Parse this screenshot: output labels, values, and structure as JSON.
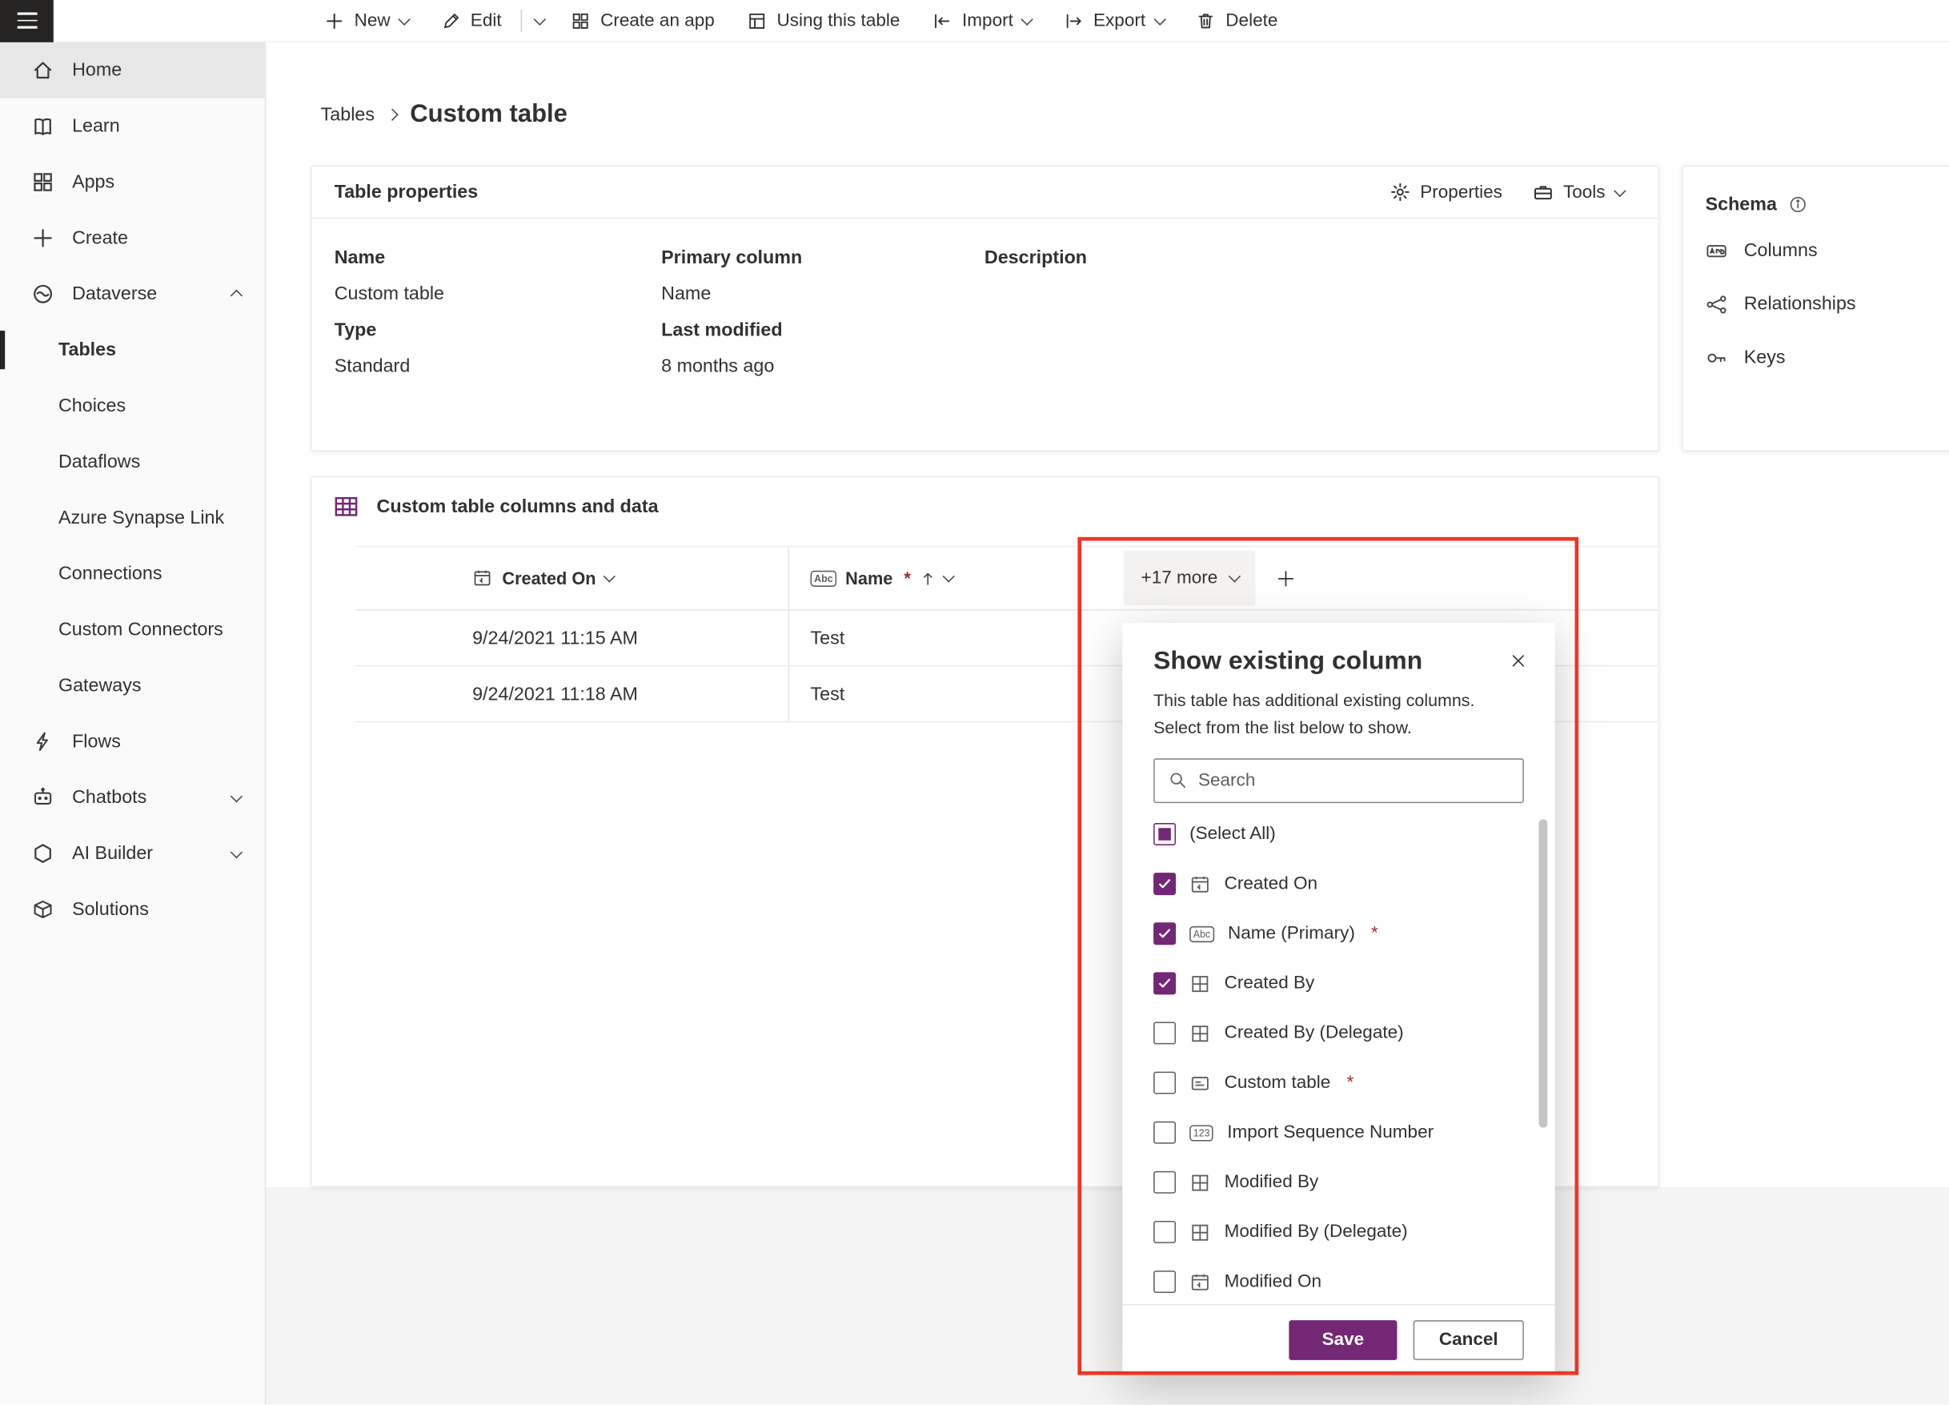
{
  "colors": {
    "accent_purple": "#742774",
    "annotation_red": "#ee3524",
    "nav_selected_bar": "#252423",
    "required_red": "#a4262c"
  },
  "icons": {
    "abc_badge": "Abc",
    "number_badge": "123"
  },
  "topbar": {
    "items": [
      {
        "label": "New",
        "icon": "plus-icon",
        "has_chevron": true
      },
      {
        "label": "Edit",
        "icon": "pencil-icon",
        "has_chevron": true
      },
      {
        "label": "Create an app",
        "icon": "create-app-icon"
      },
      {
        "label": "Using this table",
        "icon": "table-app-icon"
      },
      {
        "label": "Import",
        "icon": "import-icon",
        "has_chevron": true
      },
      {
        "label": "Export",
        "icon": "export-icon",
        "has_chevron": true
      },
      {
        "label": "Delete",
        "icon": "trash-icon"
      }
    ]
  },
  "sidebar": {
    "items": [
      {
        "label": "Home"
      },
      {
        "label": "Learn"
      },
      {
        "label": "Apps"
      },
      {
        "label": "Create"
      },
      {
        "label": "Dataverse",
        "expanded": true
      },
      {
        "label": "Tables",
        "selected": true
      },
      {
        "label": "Choices"
      },
      {
        "label": "Dataflows"
      },
      {
        "label": "Azure Synapse Link"
      },
      {
        "label": "Connections"
      },
      {
        "label": "Custom Connectors"
      },
      {
        "label": "Gateways"
      },
      {
        "label": "Flows"
      },
      {
        "label": "Chatbots",
        "collapsed": true
      },
      {
        "label": "AI Builder",
        "collapsed": true
      },
      {
        "label": "Solutions"
      }
    ]
  },
  "breadcrumb": {
    "root": "Tables",
    "current": "Custom table"
  },
  "properties_card": {
    "title": "Table properties",
    "properties_button": "Properties",
    "tools_button": "Tools",
    "name_label": "Name",
    "name_value": "Custom table",
    "type_label": "Type",
    "type_value": "Standard",
    "primary_column_label": "Primary column",
    "primary_column_value": "Name",
    "last_modified_label": "Last modified",
    "last_modified_value": "8 months ago",
    "description_label": "Description",
    "description_value": ""
  },
  "schema_card": {
    "title": "Schema",
    "items": [
      {
        "label": "Columns"
      },
      {
        "label": "Relationships"
      },
      {
        "label": "Keys"
      }
    ]
  },
  "data_card": {
    "title": "Custom table columns and data",
    "created_on_header": "Created On",
    "name_header": "Name",
    "required_marker": "*",
    "more_columns_button": "+17 more",
    "rows": [
      {
        "created_on": "9/24/2021 11:15 AM",
        "name": "Test"
      },
      {
        "created_on": "9/24/2021 11:18 AM",
        "name": "Test"
      }
    ]
  },
  "dialog": {
    "title": "Show existing column",
    "description": "This table has additional existing columns. Select from the list below to show.",
    "search_placeholder": "Search",
    "required_marker": "*",
    "items": [
      {
        "label": "(Select All)",
        "state": "indeterminate"
      },
      {
        "label": "Created On",
        "state": "checked",
        "icon": "calendar-icon"
      },
      {
        "label": "Name (Primary)",
        "state": "checked",
        "required": true,
        "icon": "abc-icon"
      },
      {
        "label": "Created By",
        "state": "checked",
        "icon": "lookup-icon"
      },
      {
        "label": "Created By (Delegate)",
        "state": "unchecked",
        "icon": "lookup-icon"
      },
      {
        "label": "Custom table",
        "state": "unchecked",
        "required": true,
        "icon": "card-icon"
      },
      {
        "label": "Import Sequence Number",
        "state": "unchecked",
        "icon": "number-icon"
      },
      {
        "label": "Modified By",
        "state": "unchecked",
        "icon": "lookup-icon"
      },
      {
        "label": "Modified By (Delegate)",
        "state": "unchecked",
        "icon": "lookup-icon"
      },
      {
        "label": "Modified On",
        "state": "unchecked",
        "icon": "calendar-icon"
      }
    ],
    "save_button": "Save",
    "cancel_button": "Cancel"
  }
}
